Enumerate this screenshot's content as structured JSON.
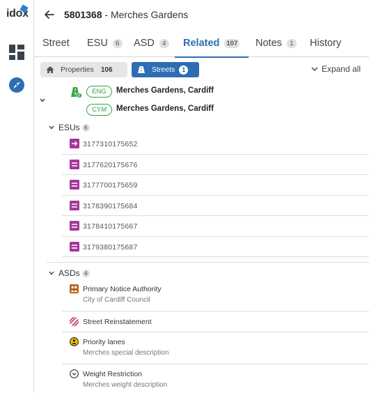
{
  "app": {
    "logo_text": "idox"
  },
  "header": {
    "usrn": "5801368",
    "separator": " - ",
    "street_name": "Merches Gardens"
  },
  "tabs": [
    {
      "label": "Street",
      "count": ""
    },
    {
      "label": "ESU",
      "count": "6"
    },
    {
      "label": "ASD",
      "count": "4"
    },
    {
      "label": "Related",
      "count": "107",
      "active": true
    },
    {
      "label": "Notes",
      "count": "1"
    },
    {
      "label": "History",
      "count": ""
    }
  ],
  "filters": {
    "properties_label": "Properties",
    "properties_count": "106",
    "streets_label": "Streets",
    "streets_count": "1",
    "expand_all_label": "Expand all"
  },
  "street": {
    "descriptors": [
      {
        "lang": "ENG",
        "name": "Merches Gardens, Cardiff"
      },
      {
        "lang": "CYM",
        "name": "Merches Gardens, Cardiff"
      }
    ]
  },
  "esus": {
    "label": "ESUs",
    "count": "6",
    "items": [
      "3177310175652",
      "3177620175676",
      "3177700175659",
      "3178390175684",
      "3178410175667",
      "3179380175687"
    ]
  },
  "asds": {
    "label": "ASDs",
    "count": "4",
    "items": [
      {
        "title": "Primary Notice Authority",
        "subtitle": "City of Cardiff Council",
        "icon": "people-icon"
      },
      {
        "title": "Street Reinstatement",
        "subtitle": "",
        "icon": "hatch-icon"
      },
      {
        "title": "Priority lanes",
        "subtitle": "Merches special description",
        "icon": "person-circle-icon"
      },
      {
        "title": "Weight Restriction",
        "subtitle": "Merches weight description",
        "icon": "chevron-circle-icon"
      }
    ]
  },
  "colors": {
    "accent": "#2e6db4",
    "esu": "#a3389a",
    "lang": "#33a04a"
  }
}
